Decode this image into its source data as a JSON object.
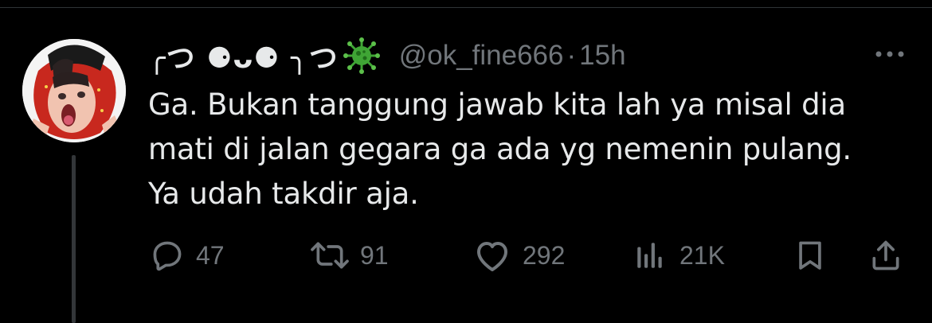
{
  "tweet": {
    "display_name": "╭つ ⚈ᴗ⚈ ╮つ",
    "name_emoji_icon": "microbe-icon",
    "handle": "@ok_fine666",
    "separator": "·",
    "time": "15h",
    "text_lines": [
      "Ga. Bukan tanggung jawab kita lah ya misal dia",
      "mati di jalan gegara ga ada yg nemenin pulang.",
      "Ya udah takdir aja."
    ],
    "more_icon": "more-horizontal-icon"
  },
  "actions": {
    "reply": {
      "icon": "reply-icon",
      "count": "47"
    },
    "retweet": {
      "icon": "retweet-icon",
      "count": "91"
    },
    "like": {
      "icon": "heart-icon",
      "count": "292"
    },
    "views": {
      "icon": "views-icon",
      "count": "21K"
    },
    "bookmark": {
      "icon": "bookmark-icon"
    },
    "share": {
      "icon": "share-icon"
    }
  },
  "colors": {
    "background": "#000000",
    "text": "#e7e9ea",
    "secondary": "#71767b",
    "border": "#2f3336",
    "virus_green": "#3fa535"
  }
}
